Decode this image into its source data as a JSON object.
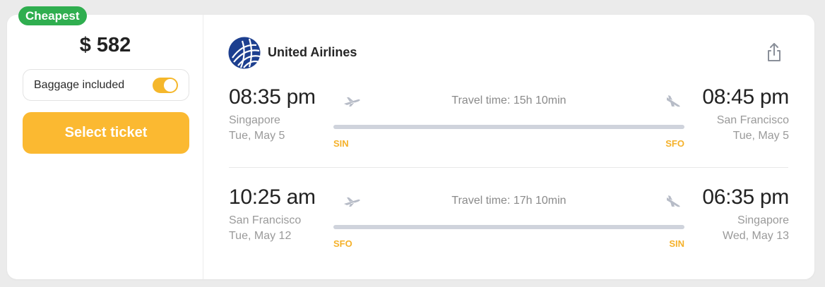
{
  "badge": {
    "label": "Cheapest",
    "color": "#2fae4f"
  },
  "price": "$ 582",
  "baggage": {
    "label": "Baggage included",
    "enabled": true,
    "toggle_color": "#f5b72b"
  },
  "select_button": {
    "label": "Select ticket",
    "color": "#fbb931"
  },
  "airline": {
    "name": "United Airlines",
    "logo_icon": "united-globe-icon"
  },
  "share": {
    "icon": "share-icon"
  },
  "legs": [
    {
      "departure": {
        "time": "08:35 pm",
        "city": "Singapore",
        "date": "Tue, May 5",
        "code": "SIN"
      },
      "arrival": {
        "time": "08:45 pm",
        "city": "San Francisco",
        "date": "Tue, May 5",
        "code": "SFO"
      },
      "travel_time": "Travel time: 15h 10min"
    },
    {
      "departure": {
        "time": "10:25 am",
        "city": "San Francisco",
        "date": "Tue, May 12",
        "code": "SFO"
      },
      "arrival": {
        "time": "06:35 pm",
        "city": "Singapore",
        "date": "Wed, May 13",
        "code": "SIN"
      },
      "travel_time": "Travel time: 17h 10min"
    }
  ]
}
